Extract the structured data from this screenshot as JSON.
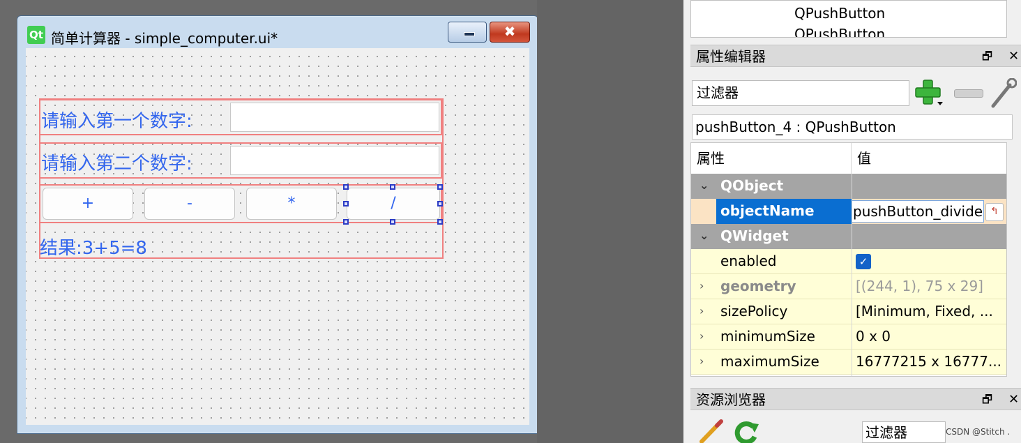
{
  "form_window": {
    "logo": "Qt",
    "title": "简单计算器 - simple_computer.ui*",
    "close_glyph": "✖",
    "labels": {
      "first_number": "请输入第一个数字:",
      "second_number": "请输入第二个数字:",
      "result": "结果:3+5=8"
    },
    "buttons": [
      "+",
      "-",
      "*",
      "/"
    ]
  },
  "object_inspector": {
    "items": [
      "QPushButton",
      "QPushButton"
    ]
  },
  "property_editor": {
    "title": "属性编辑器",
    "float_glyph": "🗗",
    "close_glyph": "✕",
    "filter_value": "过滤器",
    "object_heading": "pushButton_4 : QPushButton",
    "columns": {
      "property": "属性",
      "value": "值"
    },
    "groups": {
      "qobject": "QObject",
      "qwidget": "QWidget"
    },
    "rows": {
      "objectName": {
        "name": "objectName",
        "value": "pushButton_divide"
      },
      "enabled": {
        "name": "enabled",
        "checked": true
      },
      "geometry": {
        "name": "geometry",
        "value": "[(244, 1), 75 x 29]"
      },
      "sizePolicy": {
        "name": "sizePolicy",
        "value": "[Minimum, Fixed, ..."
      },
      "minimumSize": {
        "name": "minimumSize",
        "value": "0 x 0"
      },
      "maximumSize": {
        "name": "maximumSize",
        "value": "16777215 x 16777..."
      }
    },
    "reset_glyph": "↰",
    "chevron_expanded": "⌄",
    "chevron_collapsed": "›"
  },
  "resource_browser": {
    "title": "资源浏览器",
    "float_glyph": "🗗",
    "close_glyph": "✕",
    "filter_value": "过滤器"
  },
  "watermark": "CSDN @Stitch .",
  "colors": {
    "label_blue": "#3366ee",
    "layout_red": "#f08080",
    "selection_blue": "#0a6ed1",
    "group_gray": "#a5a5a5",
    "row_yellow": "#fffed7"
  }
}
